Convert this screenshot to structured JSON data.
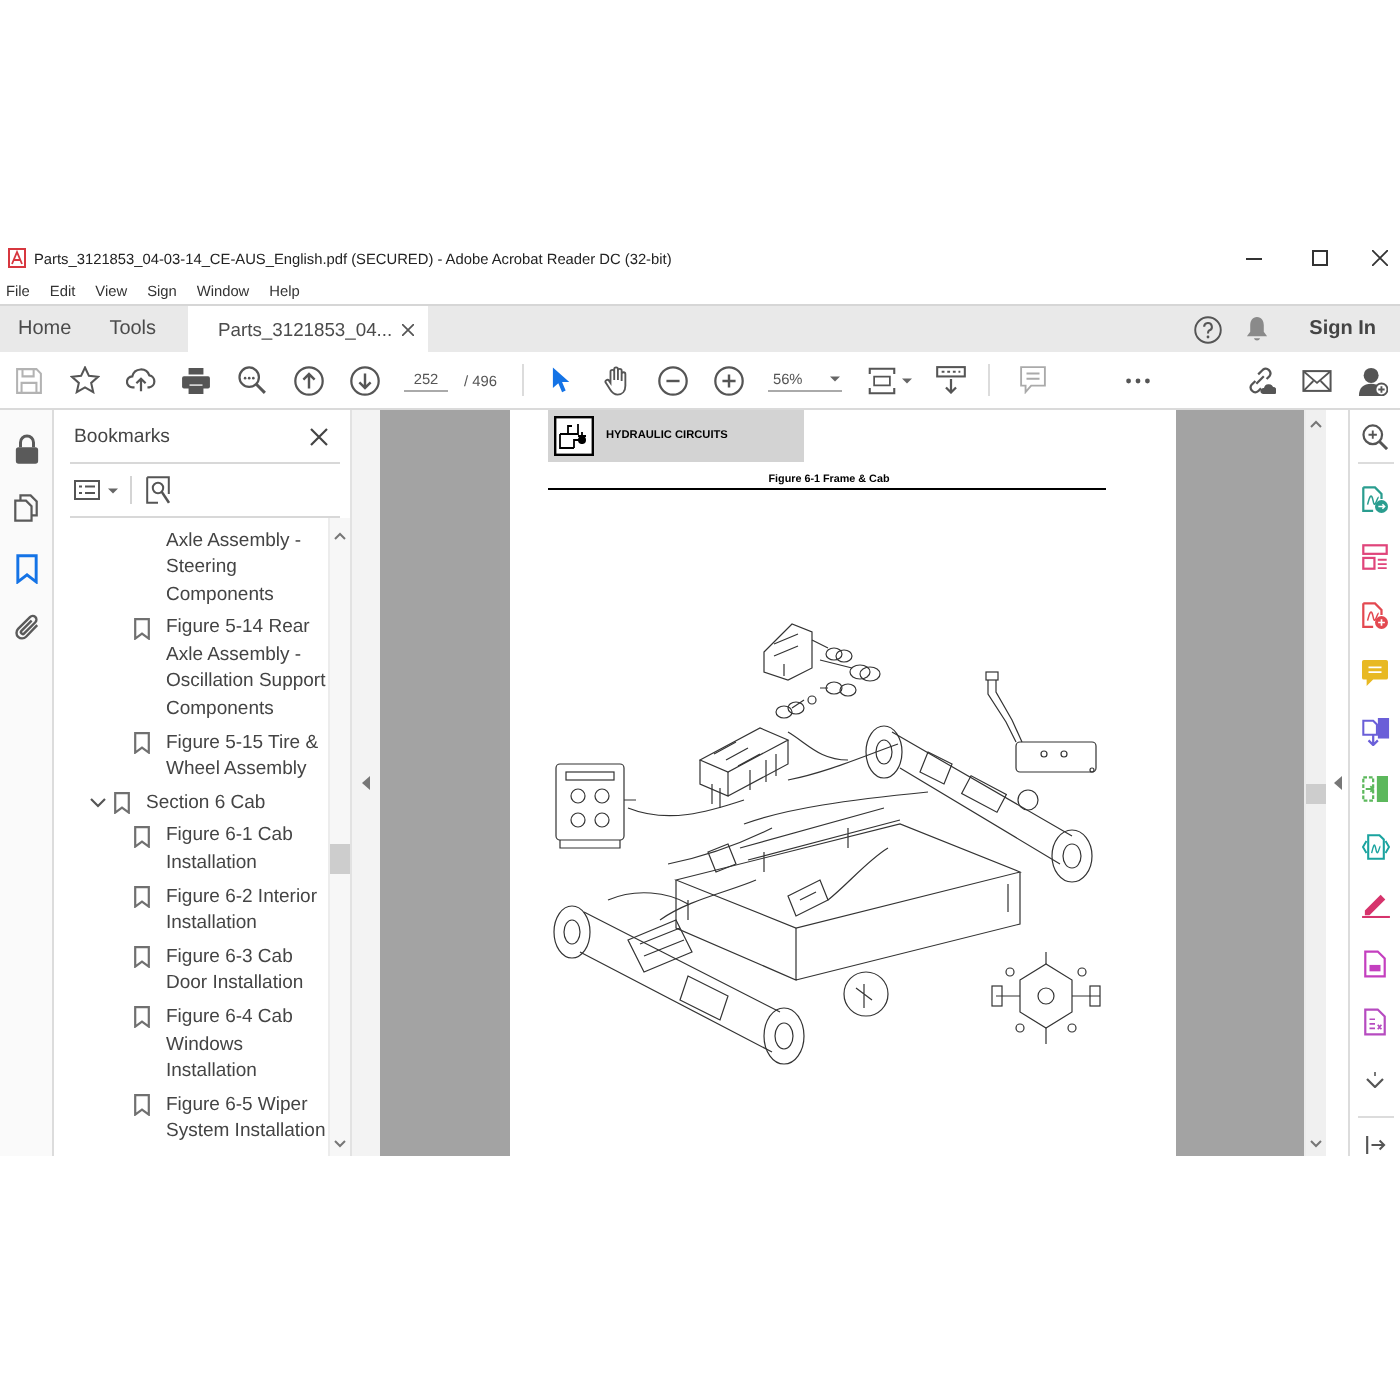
{
  "window": {
    "title": "Parts_3121853_04-03-14_CE-AUS_English.pdf (SECURED) - Adobe Acrobat Reader DC (32-bit)"
  },
  "menu": [
    "File",
    "Edit",
    "View",
    "Sign",
    "Window",
    "Help"
  ],
  "tabs": [
    {
      "label": "Home",
      "selected": false,
      "closable": false
    },
    {
      "label": "Tools",
      "selected": false,
      "closable": false
    },
    {
      "label": "Parts_3121853_04...",
      "selected": true,
      "closable": true
    }
  ],
  "account": {
    "sign_in": "Sign In"
  },
  "toolbar": {
    "page": "252",
    "page_count": "/ 496",
    "zoom": "56%"
  },
  "left_nav": [
    {
      "kind": "lock",
      "selected": false
    },
    {
      "kind": "pages",
      "selected": false
    },
    {
      "kind": "bookmarks",
      "selected": true
    },
    {
      "kind": "attachments",
      "selected": false
    }
  ],
  "bookmarks": {
    "title": "Bookmarks",
    "items": [
      {
        "children": [
          {
            "kind": "continued",
            "label": "Axle Assembly - Steering Components"
          },
          {
            "kind": "bookmark",
            "label": "Figure 5-14 Rear Axle Assembly - Oscillation Support Components"
          },
          {
            "kind": "bookmark",
            "label": "Figure 5-15 Tire & Wheel Assembly"
          }
        ]
      },
      {
        "kind": "bookmark",
        "label": "Section 6 Cab",
        "expanded": true,
        "children": [
          {
            "kind": "bookmark",
            "label": "Figure 6-1 Cab Installation"
          },
          {
            "kind": "bookmark",
            "label": "Figure 6-2 Interior Installation"
          },
          {
            "kind": "bookmark",
            "label": "Figure 6-3 Cab Door Installation"
          },
          {
            "kind": "bookmark",
            "label": "Figure 6-4 Cab Windows Installation"
          },
          {
            "kind": "bookmark",
            "label": "Figure 6-5 Wiper System Installation"
          }
        ]
      }
    ]
  },
  "page": {
    "header": "HYDRAULIC CIRCUITS",
    "figure_title": "Figure 6-1 Frame & Cab"
  }
}
